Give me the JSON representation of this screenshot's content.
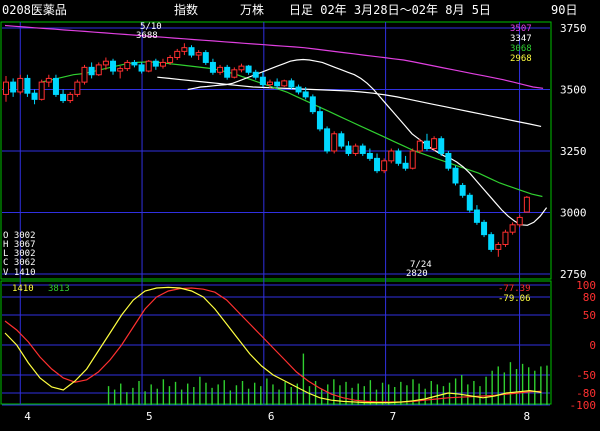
{
  "header": {
    "symbol": "0208医薬品",
    "kind": "指数",
    "unit": "万株",
    "period": "日足 02年 3月28日～02年 8月 5日",
    "count": "90日"
  },
  "colors": {
    "price_frame": "#00c000",
    "grid": "#3030e0",
    "up": "#ff3030",
    "down": "#00d8ff",
    "ma_short": "#ffffff",
    "ma_mid": "#30d030",
    "ma_long": "#e040e0",
    "osc_fast": "#ffff40",
    "osc_slow": "#ff3030",
    "volume": "#30d030",
    "axis_text": "#ffffff",
    "label_text": "#ffffff"
  },
  "ohlcv": {
    "open": "O 3002",
    "high": "H 3067",
    "low": "L 3002",
    "close": "C 3062",
    "volume": "V 1410"
  },
  "ma_values": [
    "3507",
    "3347",
    "3068",
    "2968"
  ],
  "annotations": {
    "high_date": "5/10",
    "high_value": "3688",
    "low_date": "7/24",
    "low_value": "2820"
  },
  "volume_labels": {
    "latest": "1410",
    "average": "3813"
  },
  "osc_values": [
    "-77.39",
    "-79.06"
  ],
  "chart_data": {
    "type": "candlestick",
    "price_axis": {
      "min": 2750,
      "max": 3750,
      "ticks": [
        2750,
        3000,
        3250,
        3500,
        3750
      ]
    },
    "osc_axis": {
      "min": -100,
      "max": 100,
      "ticks": [
        100,
        80,
        50,
        0,
        -50,
        -80,
        -100
      ]
    },
    "month_labels": [
      "4",
      "5",
      "6",
      "7",
      "8"
    ],
    "month_day_index": [
      3,
      23,
      43,
      63,
      85
    ],
    "candles": [
      [
        3480,
        3555,
        3450,
        3530
      ],
      [
        3530,
        3545,
        3470,
        3490
      ],
      [
        3490,
        3560,
        3480,
        3545
      ],
      [
        3545,
        3560,
        3470,
        3485
      ],
      [
        3485,
        3500,
        3440,
        3460
      ],
      [
        3460,
        3540,
        3455,
        3530
      ],
      [
        3530,
        3560,
        3510,
        3545
      ],
      [
        3545,
        3560,
        3470,
        3480
      ],
      [
        3480,
        3500,
        3445,
        3455
      ],
      [
        3455,
        3490,
        3445,
        3480
      ],
      [
        3480,
        3540,
        3470,
        3530
      ],
      [
        3530,
        3600,
        3520,
        3590
      ],
      [
        3590,
        3610,
        3545,
        3560
      ],
      [
        3560,
        3610,
        3555,
        3600
      ],
      [
        3600,
        3630,
        3580,
        3615
      ],
      [
        3615,
        3625,
        3560,
        3575
      ],
      [
        3575,
        3595,
        3545,
        3585
      ],
      [
        3585,
        3620,
        3575,
        3610
      ],
      [
        3610,
        3620,
        3590,
        3600
      ],
      [
        3600,
        3610,
        3565,
        3575
      ],
      [
        3575,
        3620,
        3570,
        3615
      ],
      [
        3615,
        3625,
        3580,
        3595
      ],
      [
        3595,
        3625,
        3585,
        3610
      ],
      [
        3610,
        3640,
        3600,
        3630
      ],
      [
        3630,
        3665,
        3620,
        3655
      ],
      [
        3655,
        3688,
        3640,
        3670
      ],
      [
        3670,
        3680,
        3630,
        3640
      ],
      [
        3640,
        3660,
        3620,
        3650
      ],
      [
        3650,
        3660,
        3600,
        3610
      ],
      [
        3610,
        3625,
        3560,
        3570
      ],
      [
        3570,
        3600,
        3560,
        3590
      ],
      [
        3590,
        3600,
        3540,
        3550
      ],
      [
        3550,
        3590,
        3545,
        3580
      ],
      [
        3580,
        3605,
        3570,
        3595
      ],
      [
        3595,
        3600,
        3560,
        3570
      ],
      [
        3570,
        3580,
        3540,
        3550
      ],
      [
        3550,
        3570,
        3510,
        3520
      ],
      [
        3520,
        3540,
        3505,
        3530
      ],
      [
        3530,
        3545,
        3505,
        3515
      ],
      [
        3515,
        3540,
        3510,
        3535
      ],
      [
        3535,
        3545,
        3500,
        3510
      ],
      [
        3510,
        3520,
        3480,
        3490
      ],
      [
        3490,
        3510,
        3460,
        3470
      ],
      [
        3470,
        3480,
        3400,
        3410
      ],
      [
        3410,
        3430,
        3330,
        3340
      ],
      [
        3340,
        3350,
        3240,
        3250
      ],
      [
        3250,
        3330,
        3240,
        3320
      ],
      [
        3320,
        3330,
        3260,
        3270
      ],
      [
        3270,
        3290,
        3230,
        3240
      ],
      [
        3240,
        3280,
        3230,
        3270
      ],
      [
        3270,
        3280,
        3230,
        3240
      ],
      [
        3240,
        3260,
        3210,
        3220
      ],
      [
        3220,
        3240,
        3160,
        3170
      ],
      [
        3170,
        3220,
        3160,
        3210
      ],
      [
        3210,
        3260,
        3200,
        3250
      ],
      [
        3250,
        3260,
        3190,
        3200
      ],
      [
        3200,
        3230,
        3170,
        3180
      ],
      [
        3180,
        3260,
        3175,
        3250
      ],
      [
        3250,
        3300,
        3240,
        3290
      ],
      [
        3290,
        3320,
        3250,
        3260
      ],
      [
        3260,
        3310,
        3250,
        3300
      ],
      [
        3300,
        3310,
        3230,
        3240
      ],
      [
        3240,
        3250,
        3170,
        3180
      ],
      [
        3180,
        3190,
        3110,
        3120
      ],
      [
        3110,
        3120,
        3060,
        3070
      ],
      [
        3070,
        3080,
        3000,
        3010
      ],
      [
        3010,
        3030,
        2950,
        2960
      ],
      [
        2960,
        2970,
        2900,
        2910
      ],
      [
        2910,
        2920,
        2840,
        2850
      ],
      [
        2850,
        2880,
        2820,
        2870
      ],
      [
        2870,
        2930,
        2860,
        2920
      ],
      [
        2920,
        2960,
        2910,
        2950
      ],
      [
        2950,
        2990,
        2940,
        2980
      ],
      [
        3002,
        3067,
        3002,
        3062
      ]
    ],
    "ma_short": [
      3500,
      3505,
      3510,
      3512,
      3515,
      3518,
      3520,
      3525,
      3535,
      3545,
      3555,
      3565,
      3575,
      3585,
      3595,
      3605,
      3615,
      3620,
      3622,
      3620,
      3615,
      3610,
      3600,
      3590,
      3580,
      3570,
      3560,
      3545,
      3525,
      3500,
      3470,
      3440,
      3410,
      3380,
      3350,
      3320,
      3300,
      3280,
      3260,
      3245,
      3230,
      3220,
      3205,
      3185,
      3160,
      3130,
      3100,
      3070,
      3040,
      3010,
      2985,
      2965,
      2950,
      2948,
      2960,
      2985,
      3020
    ],
    "ma_mid": [
      3530,
      3540,
      3550,
      3560,
      3565,
      3575,
      3585,
      3595,
      3605,
      3610,
      3612,
      3610,
      3605,
      3600,
      3595,
      3590,
      3585,
      3575,
      3565,
      3550,
      3535,
      3520,
      3505,
      3490,
      3470,
      3450,
      3430,
      3410,
      3390,
      3370,
      3350,
      3330,
      3310,
      3290,
      3270,
      3250,
      3235,
      3220,
      3205,
      3190,
      3175,
      3160,
      3140,
      3120,
      3105,
      3090,
      3075,
      3065
    ],
    "ma_long": [
      3760,
      3757,
      3754,
      3751,
      3748,
      3745,
      3742,
      3739,
      3736,
      3733,
      3730,
      3727,
      3724,
      3721,
      3718,
      3715,
      3712,
      3709,
      3706,
      3703,
      3700,
      3697,
      3694,
      3691,
      3688,
      3685,
      3682,
      3679,
      3676,
      3673,
      3670,
      3665,
      3660,
      3655,
      3650,
      3645,
      3640,
      3635,
      3630,
      3625,
      3620,
      3612,
      3604,
      3596,
      3588,
      3580,
      3572,
      3564,
      3556,
      3548,
      3540,
      3530,
      3520,
      3510,
      3505
    ],
    "ma_wide": [
      3550,
      3545,
      3540,
      3535,
      3530,
      3525,
      3520,
      3515,
      3510,
      3508,
      3506,
      3504,
      3502,
      3500,
      3498,
      3496,
      3494,
      3490,
      3485,
      3478,
      3470,
      3460,
      3450,
      3440,
      3430,
      3420,
      3410,
      3400,
      3390,
      3380,
      3370,
      3360,
      3350
    ],
    "osc_fast": [
      20,
      0,
      -30,
      -55,
      -70,
      -75,
      -60,
      -40,
      -10,
      20,
      50,
      75,
      90,
      95,
      96,
      95,
      90,
      80,
      60,
      35,
      10,
      -15,
      -35,
      -50,
      -60,
      -70,
      -80,
      -88,
      -92,
      -94,
      -95,
      -96,
      -96,
      -96,
      -95,
      -93,
      -90,
      -85,
      -80,
      -82,
      -85,
      -88,
      -85,
      -80,
      -78,
      -76,
      -79
    ],
    "osc_slow": [
      40,
      25,
      5,
      -20,
      -40,
      -55,
      -62,
      -58,
      -45,
      -25,
      0,
      30,
      60,
      80,
      90,
      94,
      95,
      93,
      88,
      75,
      55,
      35,
      15,
      -5,
      -25,
      -45,
      -60,
      -72,
      -82,
      -88,
      -92,
      -94,
      -95,
      -95,
      -95,
      -94,
      -92,
      -90,
      -88,
      -87,
      -86,
      -85,
      -84,
      -82,
      -80,
      -78,
      -77
    ],
    "volume": [
      22,
      18,
      25,
      15,
      20,
      28,
      16,
      24,
      19,
      30,
      22,
      27,
      18,
      25,
      21,
      33,
      26,
      20,
      24,
      29,
      17,
      23,
      28,
      19,
      26,
      22,
      31,
      24,
      18,
      27,
      21,
      25,
      60,
      22,
      28,
      19,
      24,
      30,
      23,
      27,
      20,
      25,
      22,
      29,
      18,
      26,
      24,
      21,
      27,
      23,
      30,
      25,
      19,
      28,
      24,
      22,
      26,
      31,
      35,
      24,
      28,
      22,
      33,
      40,
      45,
      38,
      50,
      42,
      48,
      44,
      40,
      45,
      46
    ]
  }
}
